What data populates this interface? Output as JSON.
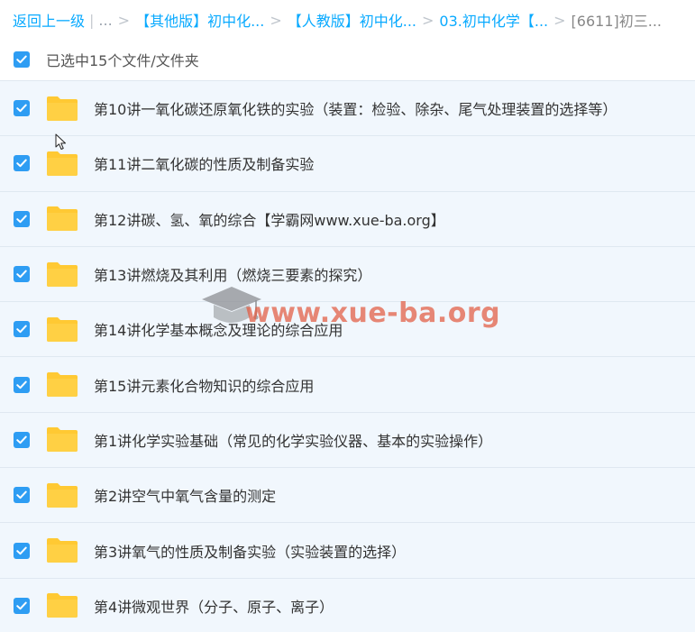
{
  "breadcrumb": {
    "back_label": "返回上一级",
    "pipe": "|",
    "ellipsis": "...",
    "separator": ">",
    "items": [
      {
        "label": "【其他版】初中化..."
      },
      {
        "label": "【人教版】初中化..."
      },
      {
        "label": "03.初中化学【..."
      }
    ],
    "current": "[6611]初三..."
  },
  "select_all": {
    "label": "已选中15个文件/文件夹",
    "checked": true
  },
  "files": [
    {
      "name": "第10讲一氧化碳还原氧化铁的实验（装置：检验、除杂、尾气处理装置的选择等）",
      "checked": true,
      "icon": "folder-icon"
    },
    {
      "name": "第11讲二氧化碳的性质及制备实验",
      "checked": true,
      "icon": "folder-icon"
    },
    {
      "name": "第12讲碳、氢、氧的综合【学霸网www.xue-ba.org】",
      "checked": true,
      "icon": "folder-icon"
    },
    {
      "name": "第13讲燃烧及其利用（燃烧三要素的探究）",
      "checked": true,
      "icon": "folder-icon"
    },
    {
      "name": "第14讲化学基本概念及理论的综合应用",
      "checked": true,
      "icon": "folder-icon"
    },
    {
      "name": "第15讲元素化合物知识的综合应用",
      "checked": true,
      "icon": "folder-icon"
    },
    {
      "name": "第1讲化学实验基础（常见的化学实验仪器、基本的实验操作）",
      "checked": true,
      "icon": "folder-icon"
    },
    {
      "name": "第2讲空气中氧气含量的测定",
      "checked": true,
      "icon": "folder-icon"
    },
    {
      "name": "第3讲氧气的性质及制备实验（实验装置的选择）",
      "checked": true,
      "icon": "folder-icon"
    },
    {
      "name": "第4讲微观世界（分子、原子、离子）",
      "checked": true,
      "icon": "folder-icon"
    }
  ],
  "watermark": {
    "text": "www.xue-ba.org"
  },
  "colors": {
    "link": "#09aaff",
    "checkbox": "#2e9df3",
    "row_background": "#f1f7fd",
    "row_border": "#dfe8f1",
    "folder": "#ffc933",
    "watermark": "#e25a40"
  }
}
